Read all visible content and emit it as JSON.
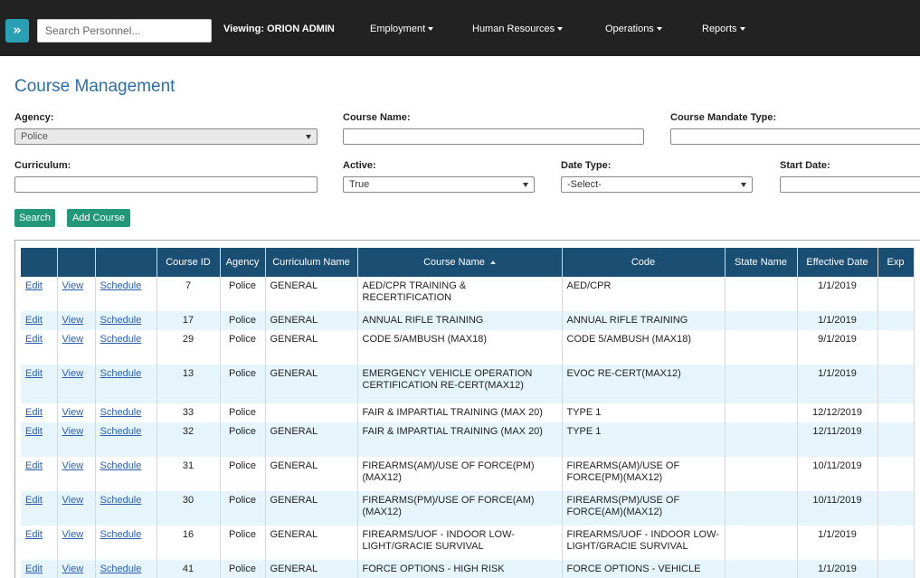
{
  "nav": {
    "toggle_glyph": "»",
    "search_placeholder": "Search Personnel...",
    "viewing": "Viewing: ORION ADMIN",
    "menus": [
      "Employment",
      "Human Resources",
      "Operations",
      "Reports"
    ]
  },
  "page": {
    "title": "Course Management"
  },
  "filters": {
    "agency": {
      "label": "Agency:",
      "value": "Police"
    },
    "course_name": {
      "label": "Course Name:",
      "value": ""
    },
    "mandate_type": {
      "label": "Course Mandate Type:",
      "value": ""
    },
    "curriculum": {
      "label": "Curriculum:",
      "value": ""
    },
    "active": {
      "label": "Active:",
      "value": "True"
    },
    "date_type": {
      "label": "Date Type:",
      "value": "-Select-"
    },
    "start_date": {
      "label": "Start Date:",
      "value": ""
    }
  },
  "buttons": {
    "search": "Search",
    "add_course": "Add Course"
  },
  "table": {
    "columns": [
      "",
      "",
      "",
      "Course ID",
      "Agency",
      "Curriculum Name",
      "Course Name",
      "Code",
      "State Name",
      "Effective Date",
      "Exp"
    ],
    "link_labels": {
      "edit": "Edit",
      "view": "View",
      "schedule": "Schedule"
    },
    "rows": [
      {
        "id": "7",
        "agency": "Police",
        "curriculum": "GENERAL",
        "course": "AED/CPR TRAINING & RECERTIFICATION",
        "code": "AED/CPR",
        "state": "",
        "effective": "1/1/2019"
      },
      {
        "id": "17",
        "agency": "Police",
        "curriculum": "GENERAL",
        "course": "ANNUAL RIFLE TRAINING",
        "code": "ANNUAL RIFLE TRAINING",
        "state": "",
        "effective": "1/1/2019"
      },
      {
        "id": "29",
        "agency": "Police",
        "curriculum": "GENERAL",
        "course": "CODE 5/AMBUSH (MAX18)",
        "code": "CODE 5/AMBUSH (MAX18)",
        "state": "",
        "effective": "9/1/2019"
      },
      {
        "id": "13",
        "agency": "Police",
        "curriculum": "GENERAL",
        "course": "EMERGENCY VEHICLE OPERATION CERTIFICATION RE-CERT(MAX12)",
        "code": "EVOC RE-CERT(MAX12)",
        "state": "",
        "effective": "1/1/2019"
      },
      {
        "id": "33",
        "agency": "Police",
        "curriculum": "",
        "course": "FAIR & IMPARTIAL TRAINING (MAX 20)",
        "code": "TYPE 1",
        "state": "",
        "effective": "12/12/2019"
      },
      {
        "id": "32",
        "agency": "Police",
        "curriculum": "GENERAL",
        "course": "FAIR & IMPARTIAL TRAINING (MAX 20)",
        "code": "TYPE 1",
        "state": "",
        "effective": "12/11/2019"
      },
      {
        "id": "31",
        "agency": "Police",
        "curriculum": "GENERAL",
        "course": "FIREARMS(AM)/USE OF FORCE(PM) (MAX12)",
        "code": "FIREARMS(AM)/USE OF FORCE(PM)(MAX12)",
        "state": "",
        "effective": "10/11/2019"
      },
      {
        "id": "30",
        "agency": "Police",
        "curriculum": "GENERAL",
        "course": "FIREARMS(PM)/USE OF FORCE(AM) (MAX12)",
        "code": "FIREARMS(PM)/USE OF FORCE(AM)(MAX12)",
        "state": "",
        "effective": "10/11/2019"
      },
      {
        "id": "16",
        "agency": "Police",
        "curriculum": "GENERAL",
        "course": "FIREARMS/UOF - INDOOR LOW-LIGHT/GRACIE SURVIVAL",
        "code": "FIREARMS/UOF - INDOOR LOW-LIGHT/GRACIE SURVIVAL",
        "state": "",
        "effective": "1/1/2019"
      },
      {
        "id": "41",
        "agency": "Police",
        "curriculum": "GENERAL",
        "course": "FORCE OPTIONS - HIGH RISK",
        "code": "FORCE OPTIONS - VEHICLE",
        "state": "",
        "effective": "1/1/2019"
      }
    ]
  },
  "colors": {
    "nav_bg": "#222222",
    "header_bg": "#1b4e73",
    "accent": "#23977a",
    "title": "#2e6da4",
    "row_alt": "#e6f5fb"
  }
}
